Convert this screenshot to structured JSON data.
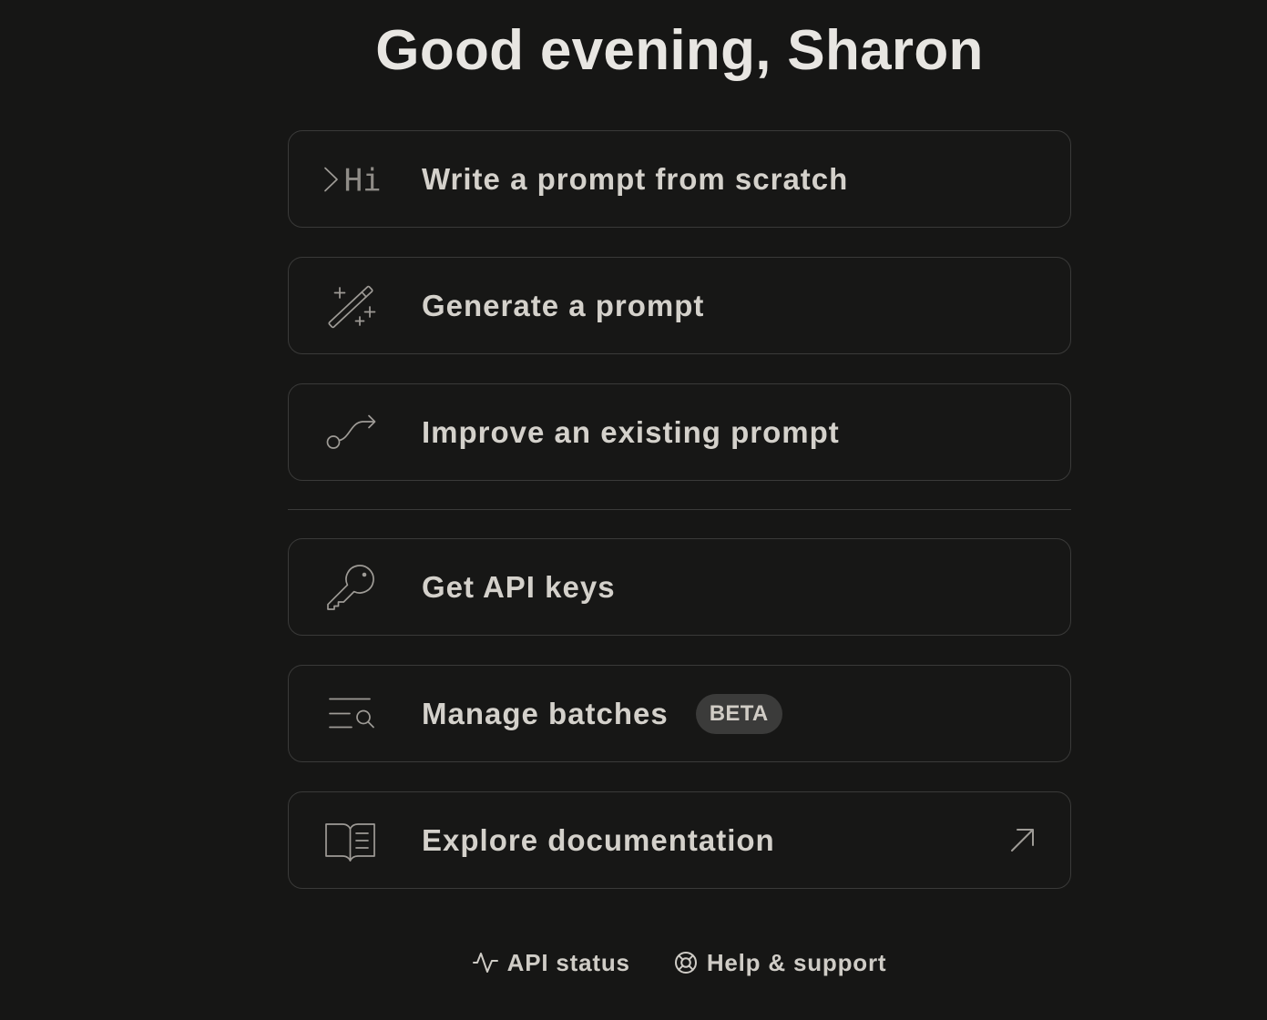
{
  "page": {
    "greeting": "Good evening, Sharon"
  },
  "actions": [
    {
      "label": "Write a prompt from scratch",
      "icon": "prompt-terminal-icon",
      "icon_text": "Hi"
    },
    {
      "label": "Generate a prompt",
      "icon": "magic-wand-icon"
    },
    {
      "label": "Improve an existing prompt",
      "icon": "path-arrow-icon"
    }
  ],
  "resources": [
    {
      "label": "Get API keys",
      "icon": "key-icon"
    },
    {
      "label": "Manage batches",
      "icon": "list-search-icon",
      "badge": "BETA"
    },
    {
      "label": "Explore documentation",
      "icon": "book-open-icon",
      "trailing_icon": "arrow-up-right-icon"
    }
  ],
  "footer": {
    "links": [
      {
        "label": "API status",
        "icon": "activity-icon"
      },
      {
        "label": "Help & support",
        "icon": "lifebuoy-icon"
      }
    ]
  },
  "colors": {
    "background": "#161615",
    "card_background": "#171716",
    "card_border": "#3a3a39",
    "text": "#d4d1cb",
    "title": "#e8e6e2",
    "icon": "#9e9b96",
    "badge_background": "#3b3b3a",
    "badge_text": "#d0ccc5",
    "footer_text": "#cfccc6"
  }
}
